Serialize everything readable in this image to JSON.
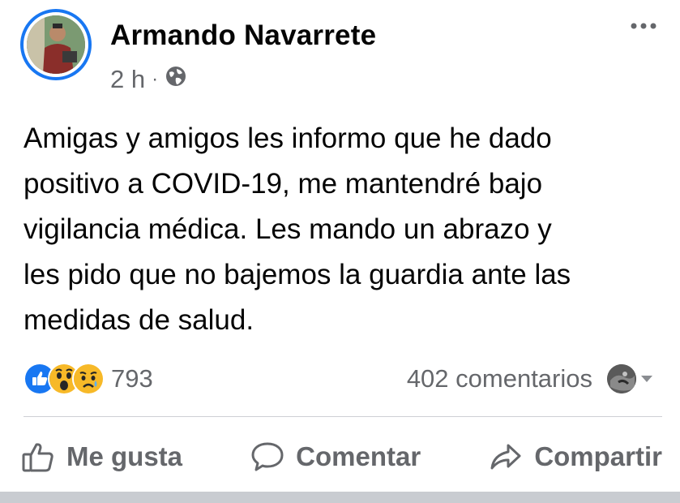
{
  "author": {
    "name": "Armando Navarrete",
    "time": "2 h",
    "separator": "·",
    "visibility_icon": "globe-icon"
  },
  "post": {
    "text": "Amigas y amigos les informo que he dado\npositivo a COVID-19, me mantendré bajo\nvigilancia médica. Les mando un abrazo y\nles pido que no bajemos la guardia ante las\nmedidas de salud."
  },
  "reactions": {
    "icons": [
      "like-icon",
      "wow-icon",
      "sad-icon"
    ],
    "count": "793"
  },
  "comments": {
    "count_label": "402 comentarios"
  },
  "actions": {
    "like_label": "Me gusta",
    "comment_label": "Comentar",
    "share_label": "Compartir"
  },
  "colors": {
    "accent": "#1877f2",
    "secondary_text": "#65676b",
    "like": "#1877f2",
    "emoji": "#f7b928"
  }
}
